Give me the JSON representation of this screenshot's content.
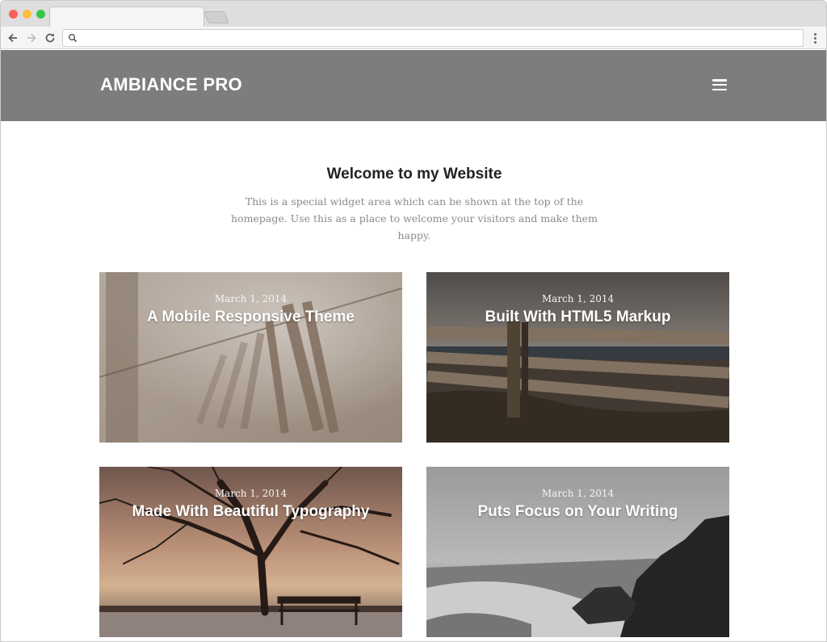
{
  "browser": {
    "url": "",
    "icons": {
      "back": "back-arrow-icon",
      "forward": "forward-arrow-icon",
      "reload": "reload-icon",
      "search": "search-icon",
      "menu": "more-vertical-icon"
    }
  },
  "header": {
    "site_title": "AMBIANCE PRO",
    "background": "#7d7d7d",
    "menu_icon": "hamburger-menu-icon"
  },
  "welcome": {
    "title": "Welcome to my Website",
    "text": "This is a special widget area which can be shown at the top of the homepage. Use this as a place to welcome your visitors and make them happy."
  },
  "posts": [
    {
      "date": "March 1, 2014",
      "title": "A Mobile Responsive Theme"
    },
    {
      "date": "March 1, 2014",
      "title": "Built With HTML5 Markup"
    },
    {
      "date": "March 1, 2014",
      "title": "Made With Beautiful Typography"
    },
    {
      "date": "March 1, 2014",
      "title": "Puts Focus on Your Writing"
    }
  ]
}
